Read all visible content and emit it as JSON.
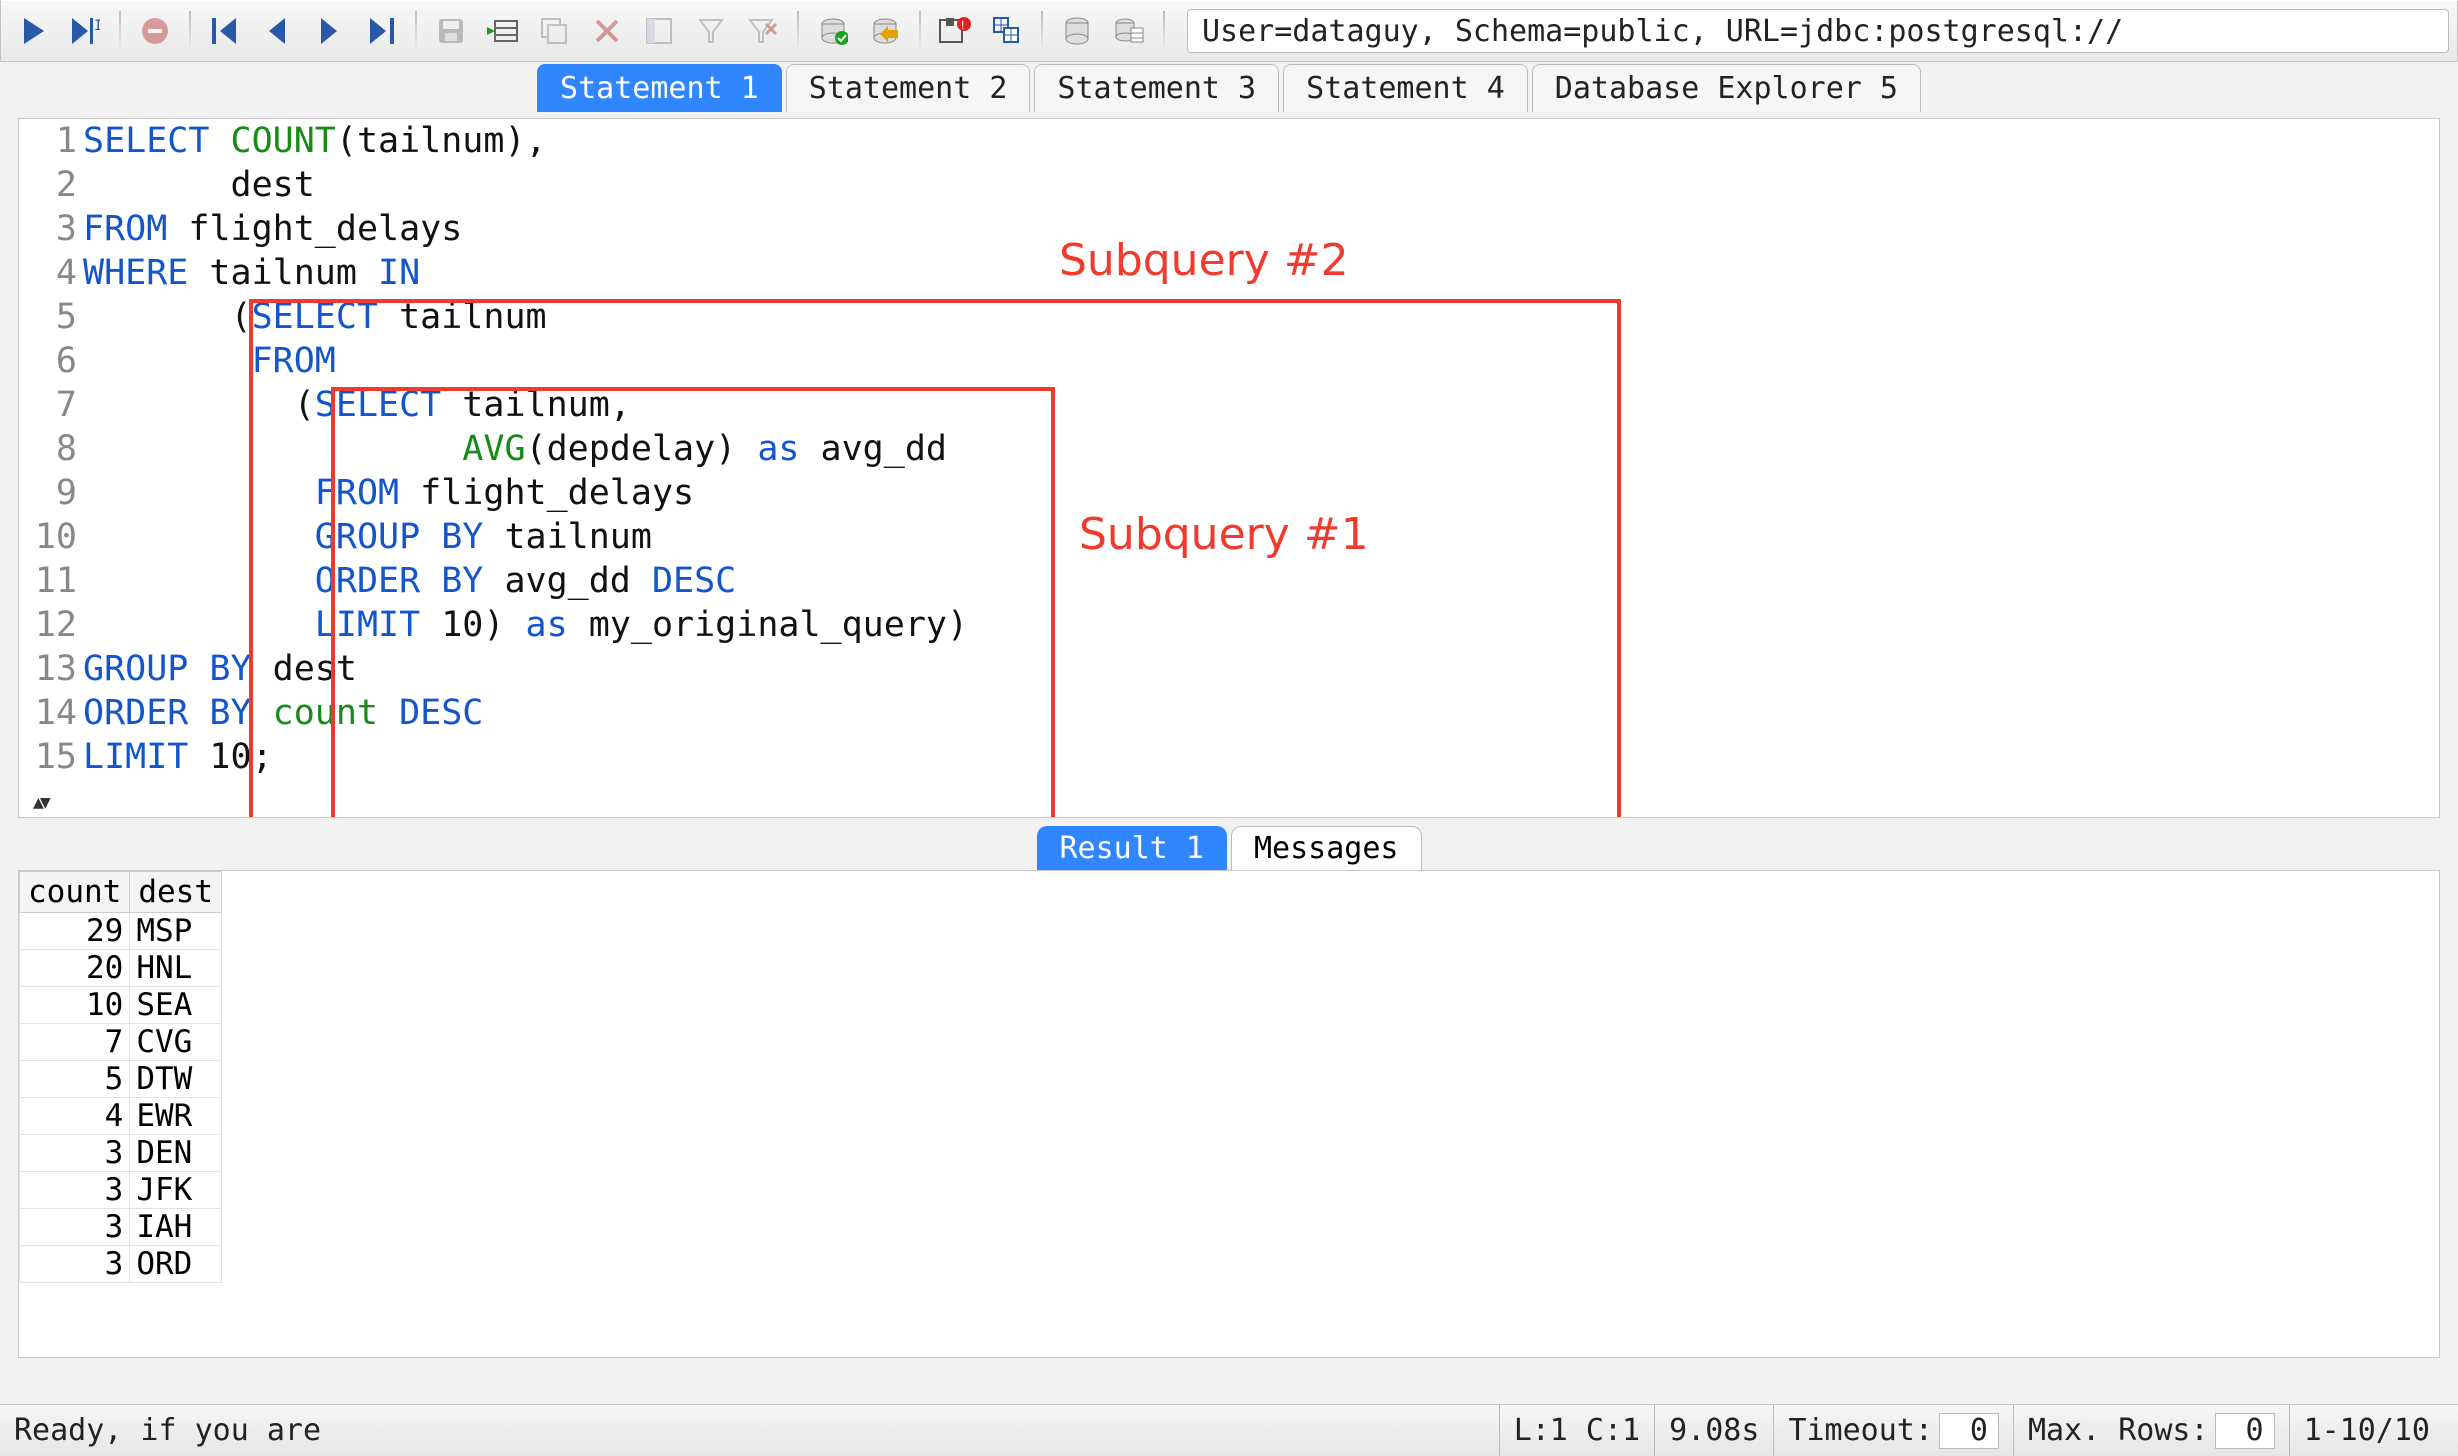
{
  "toolbar": {
    "connection": "User=dataguy, Schema=public, URL=jdbc:postgresql://"
  },
  "tabs": {
    "statements": [
      "Statement 1",
      "Statement 2",
      "Statement 3",
      "Statement 4",
      "Database Explorer 5"
    ],
    "active_statement": 0,
    "results": [
      "Result 1",
      "Messages"
    ],
    "active_result": 0
  },
  "editor": {
    "lines": [
      [
        [
          "kw",
          "SELECT"
        ],
        [
          "",
          " "
        ],
        [
          "fn",
          "COUNT"
        ],
        [
          "",
          "(tailnum),"
        ]
      ],
      [
        [
          "",
          "       dest"
        ]
      ],
      [
        [
          "kw",
          "FROM"
        ],
        [
          "",
          " flight_delays"
        ]
      ],
      [
        [
          "kw",
          "WHERE"
        ],
        [
          "",
          " tailnum "
        ],
        [
          "kw",
          "IN"
        ]
      ],
      [
        [
          "",
          "       ("
        ],
        [
          "kw",
          "SELECT"
        ],
        [
          "",
          " tailnum"
        ]
      ],
      [
        [
          "",
          "        "
        ],
        [
          "kw",
          "FROM"
        ]
      ],
      [
        [
          "",
          "          ("
        ],
        [
          "kw",
          "SELECT"
        ],
        [
          "",
          " tailnum,"
        ]
      ],
      [
        [
          "",
          "                  "
        ],
        [
          "fn",
          "AVG"
        ],
        [
          "",
          "(depdelay) "
        ],
        [
          "kw",
          "as"
        ],
        [
          "",
          " avg_dd"
        ]
      ],
      [
        [
          "",
          "           "
        ],
        [
          "kw",
          "FROM"
        ],
        [
          "",
          " flight_delays"
        ]
      ],
      [
        [
          "",
          "           "
        ],
        [
          "kw",
          "GROUP BY"
        ],
        [
          "",
          " tailnum"
        ]
      ],
      [
        [
          "",
          "           "
        ],
        [
          "kw",
          "ORDER BY"
        ],
        [
          "",
          " avg_dd "
        ],
        [
          "kw",
          "DESC"
        ]
      ],
      [
        [
          "",
          "           "
        ],
        [
          "kw",
          "LIMIT"
        ],
        [
          "",
          " 10) "
        ],
        [
          "kw",
          "as"
        ],
        [
          "",
          " my_original_query)"
        ]
      ],
      [
        [
          "kw",
          "GROUP BY"
        ],
        [
          "",
          " dest"
        ]
      ],
      [
        [
          "kw",
          "ORDER BY"
        ],
        [
          "",
          " "
        ],
        [
          "fn",
          "count"
        ],
        [
          "",
          " "
        ],
        [
          "kw",
          "DESC"
        ]
      ],
      [
        [
          "kw",
          "LIMIT"
        ],
        [
          "",
          " 10;"
        ]
      ]
    ],
    "annotations": {
      "sub2_label": "Subquery #2",
      "sub1_label": "Subquery #1"
    }
  },
  "result": {
    "columns": [
      "count",
      "dest"
    ],
    "rows": [
      {
        "count": 29,
        "dest": "MSP"
      },
      {
        "count": 20,
        "dest": "HNL"
      },
      {
        "count": 10,
        "dest": "SEA"
      },
      {
        "count": 7,
        "dest": "CVG"
      },
      {
        "count": 5,
        "dest": "DTW"
      },
      {
        "count": 4,
        "dest": "EWR"
      },
      {
        "count": 3,
        "dest": "DEN"
      },
      {
        "count": 3,
        "dest": "JFK"
      },
      {
        "count": 3,
        "dest": "IAH"
      },
      {
        "count": 3,
        "dest": "ORD"
      }
    ]
  },
  "status": {
    "ready": "Ready, if you are",
    "pos": "L:1 C:1",
    "time": "9.08s",
    "timeout_label": "Timeout:",
    "timeout_value": "0",
    "maxrows_label": "Max. Rows:",
    "maxrows_value": "0",
    "range": "1-10/10"
  }
}
